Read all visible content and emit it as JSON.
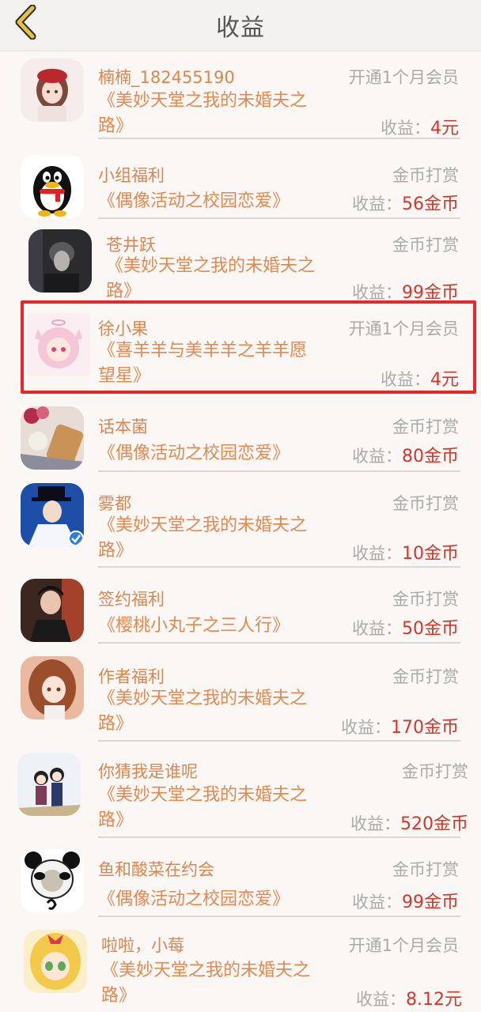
{
  "header": {
    "title": "收益",
    "back_icon": "chevron-left-icon"
  },
  "colors": {
    "name": "#d9864f",
    "book": "#e08a52",
    "value": "#d2372b",
    "muted": "#aaaaaa",
    "highlight": "#e6282a"
  },
  "earn_label": "收益：",
  "items": [
    {
      "name": "楠楠_182455190",
      "type": "开通1个月会员",
      "book_line1": "《美妙天堂之我的未婚夫之",
      "book_line2": "路》",
      "value": "4元",
      "avatar": "girl-red-hat-avatar"
    },
    {
      "name": "小组福利",
      "type": "金币打赏",
      "book_line1": "《偶像活动之校园恋爱》",
      "book_line2": "",
      "value": "56金币",
      "avatar": "penguin-avatar"
    },
    {
      "name": "苍井跃",
      "type": "金币打赏",
      "book_line1": "《美妙天堂之我的未婚夫之",
      "book_line2": "路》",
      "value": "99金币",
      "avatar": "dark-photo-avatar"
    },
    {
      "name": "徐小果",
      "type": "开通1个月会员",
      "book_line1": "《喜羊羊与美羊羊之羊羊愿",
      "book_line2": "望星》",
      "value": "4元",
      "avatar": "pink-anime-girl-avatar"
    },
    {
      "name": "话本菌",
      "type": "金币打赏",
      "book_line1": "《偶像活动之校园恋爱》",
      "book_line2": "",
      "value": "80金币",
      "avatar": "flowers-bread-avatar"
    },
    {
      "name": "雾都",
      "type": "金币打赏",
      "book_line1": "《美妙天堂之我的未婚夫之",
      "book_line2": "路》",
      "value": "10金币",
      "avatar": "kid-kaitou-avatar",
      "verified": "verified-badge-icon"
    },
    {
      "name": "签约福利",
      "type": "金币打赏",
      "book_line1": "《樱桃小丸子之三人行》",
      "book_line2": "",
      "value": "50金币",
      "avatar": "man-portrait-avatar"
    },
    {
      "name": "作者福利",
      "type": "金币打赏",
      "book_line1": "《美妙天堂之我的未婚夫之",
      "book_line2": "路》",
      "value": "170金币",
      "avatar": "anime-girl-brown-hair-avatar"
    },
    {
      "name": "你猜我是谁呢",
      "type": "金币打赏",
      "book_line1": "《美妙天堂之我的未婚夫之",
      "book_line2": "路》",
      "value": "520金币",
      "avatar": "couple-cartoon-avatar"
    },
    {
      "name": "鱼和酸菜在约会",
      "type": "金币打赏",
      "book_line1": "《偶像活动之校园恋爱》",
      "book_line2": "",
      "value": "99金币",
      "avatar": "panda-meme-avatar"
    },
    {
      "name": "啦啦，小莓",
      "type": "开通1个月会员",
      "book_line1": "《美妙天堂之我的未婚夫之",
      "book_line2": "路》",
      "value": "8.12元",
      "avatar": "blonde-anime-girl-avatar"
    }
  ]
}
